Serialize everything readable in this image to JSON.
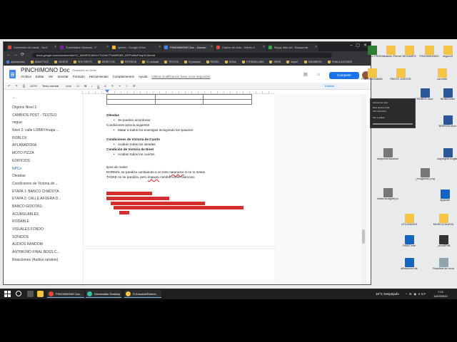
{
  "browser": {
    "tabs": [
      {
        "label": "Contenido del canal - YouT",
        "active": false
      },
      {
        "label": "TransNation Network - F",
        "active": false
      },
      {
        "label": "sprites - Google Drive",
        "active": false
      },
      {
        "label": "PINCHIMONO Doc - Docum",
        "active": true
      },
      {
        "label": "Clarion de Auto - Efecto d",
        "active": false
      },
      {
        "label": "floppy disk set - Búsqueda",
        "active": false
      }
    ],
    "url": "docs.google.com/document/d/1C_Wa3R3Cb5Vn7TkO4n7TtxMR0EE_f0FPvd9zPmqXCAl/edit",
    "bookmarks": [
      "Aplicaciones",
      "ANALYTICS",
      "VIDEOS",
      "SRV RESTS",
      "DIRECTOS",
      "PATREON",
      "IG podcast",
      "TEXTOS",
      "Kj podcast",
      "REDES",
      "GEMA",
      "XTREAM LABS",
      "RRHS",
      "kajari7",
      "MIEMBROS",
      "PUBLICACIONES"
    ]
  },
  "docs": {
    "title": "PINCHIMONO Doc",
    "saved_status": "Guardado en Drive",
    "menu": [
      "Archivo",
      "Editar",
      "Ver",
      "Insertar",
      "Formato",
      "Herramientas",
      "Complementos",
      "Ayuda"
    ],
    "last_edit": "Última modificación hace unos segundos",
    "share_label": "Compartir",
    "toolbar": {
      "zoom": "100%",
      "style": "Texto normal",
      "font": "Arial",
      "size": "11",
      "edit_mode": "Edición"
    }
  },
  "outline": {
    "items": [
      "Objetos Nivel 1:",
      "CAMBIOS POST - TESTEO",
      "negus:",
      "Nivel 2: calle LOBBY/mapa ...",
      "ROBLOX",
      "APLANADORA",
      "MOTO PIZZA",
      "EDIFICIOS",
      "NPCs",
      "Oleadas",
      "Condiciones de Victoria de ...",
      "ETAPA 1: BANCO CHADOTA",
      "ETAPA 2: CALLE AFUERA D...",
      "BANCO GIDOTAS:",
      "ACUMULABLES",
      "RODABLE",
      "VISUALES FONDO",
      "SONIDOS",
      "AUDIOS RANDOM",
      "ANTIMONO FINAL BOSS C...",
      "Reacciones (Audios random)"
    ],
    "selected_index": 8
  },
  "document": {
    "oleadas_heading": "Oleadas",
    "oleadas_bullet": "Se pueden amontonar",
    "cond_siguiente": "Condiciones para la siguiente",
    "cond_siguiente_bullet": "Matar a todos los enemigos incluyendo los spawner",
    "cond_cuarto": "Condiciones de Victoria de Cuarto",
    "cond_cuarto_bullet": "Acaban todas las oleadas",
    "cond_nivel": "Condición de Victoria de Nivel",
    "cond_nivel_bullet": "Acaban todos los cuartos",
    "tipos": "tipos de malos",
    "normal_a": "NORMAL se paraliza cambiando a un tinte ",
    "normal_word": "naranjoso",
    "normal_b": " si no lo matan",
    "tanke_a": "TANKE no se paraliza, pero ",
    "tanke_word": "impacto",
    "tanke_b": " cambia a tinte blancoso"
  },
  "desktop": {
    "icons": [
      {
        "label": "CAMAX PRO",
        "color": "#2e7d32"
      },
      {
        "label": "Grabación Premiere de Auto-Save",
        "color": "#f4c542"
      },
      {
        "label": "NEGAMES",
        "color": "#f4c542"
      },
      {
        "label": "PINCHIMUNDO",
        "color": "#f4c542"
      },
      {
        "label": "negus19",
        "color": "#f4c542"
      },
      {
        "label": "PINCHIMONAMILLA",
        "color": "#f4c542"
      },
      {
        "label": "PAVOS JUEGOS",
        "color": "#f4c542"
      },
      {
        "label": "car.knife",
        "color": "#f4c542"
      },
      {
        "label": "MOBDS.docx",
        "color": "#2b579a"
      },
      {
        "label": "MOBDSxlsx",
        "color": "#2b579a"
      },
      {
        "label": "BREEDS.docx",
        "color": "#2b579a"
      },
      {
        "label": "despuesmacalover.png",
        "color": "#777"
      },
      {
        "label": "_enugaman.png",
        "color": "#777"
      },
      {
        "label": "copyrights english.docx",
        "color": "#2b579a"
      },
      {
        "label": "lmabrosoagolll.png",
        "color": "#777"
      },
      {
        "label": "appeals",
        "color": "#1565c0"
      },
      {
        "label": "UTILIDADES",
        "color": "#f4c542"
      },
      {
        "label": "MUSICA NUEVA",
        "color": "#f4c542"
      },
      {
        "label": "PAINT.exe",
        "color": "#1565c0"
      },
      {
        "label": "_icondFHB",
        "color": "#333"
      },
      {
        "label": "dMashcon.lnk",
        "color": "#1565c0"
      },
      {
        "label": "Papelera de reciclaje",
        "color": "#90a4ae"
      }
    ],
    "download_window": {
      "lines": [
        "Almacenar todo",
        "Esta buscar nada",
        "Otro directorio",
        "Dar a grabar"
      ]
    }
  },
  "taskbar": {
    "apps": [
      {
        "label": "PINCHIMONO Doc...",
        "color": "#e8453c"
      },
      {
        "label": "Streamlabs Desktop",
        "color": "#31c3a2"
      },
      {
        "label": "D:\\Usuario\\Robert...",
        "color": "#f4c542"
      }
    ],
    "weather": "16°C  Despejado",
    "tray": "^ ✉ ◉ ESP",
    "time": "7:13",
    "date": "11/03/2022"
  }
}
